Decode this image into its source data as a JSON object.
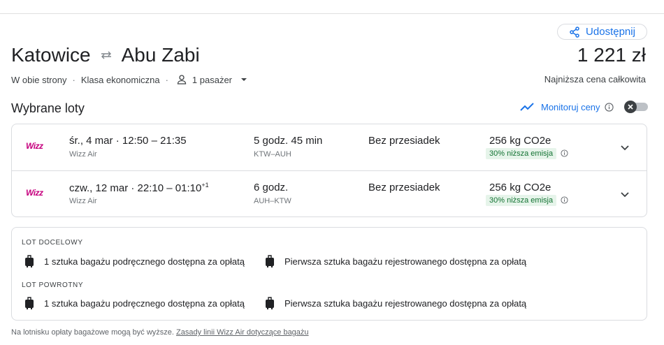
{
  "header": {
    "share_label": "Udostępnij",
    "origin": "Katowice",
    "destination": "Abu Zabi",
    "trip_type": "W obie strony",
    "cabin_class": "Klasa ekonomiczna",
    "passengers": "1 pasażer",
    "price": "1 221 zł",
    "price_label": "Najniższa cena całkowita"
  },
  "selected": {
    "title": "Wybrane loty",
    "track_prices_label": "Monitoruj ceny",
    "track_prices_enabled": false
  },
  "flights": [
    {
      "logo_text": "Wizz",
      "date": "śr., 4 mar",
      "time_range": "12:50 – 21:35",
      "day_offset": "",
      "airline": "Wizz Air",
      "duration": "5 godz. 45 min",
      "route": "KTW–AUH",
      "stops": "Bez przesiadek",
      "co2": "256 kg CO2e",
      "emission_badge": "30% niższa emisja"
    },
    {
      "logo_text": "Wizz",
      "date": "czw., 12 mar",
      "time_range": "22:10 – 01:10",
      "day_offset": "+1",
      "airline": "Wizz Air",
      "duration": "6 godz.",
      "route": "AUH–KTW",
      "stops": "Bez przesiadek",
      "co2": "256 kg CO2e",
      "emission_badge": "30% niższa emisja"
    }
  ],
  "baggage": {
    "outbound_title": "LOT DOCELOWY",
    "return_title": "LOT POWROTNY",
    "carry_on": "1 sztuka bagażu podręcznego dostępna za opłatą",
    "checked": "Pierwsza sztuka bagażu rejestrowanego dostępna za opłatą"
  },
  "footer": {
    "note": "Na lotnisku opłaty bagażowe mogą być wyższe.",
    "link": "Zasady linii Wizz Air dotyczące bagażu"
  },
  "colors": {
    "accent": "#1a73e8",
    "emission_bg": "#e6f4ea",
    "emission_text": "#137333",
    "brand_wizz": "#c6007e"
  }
}
